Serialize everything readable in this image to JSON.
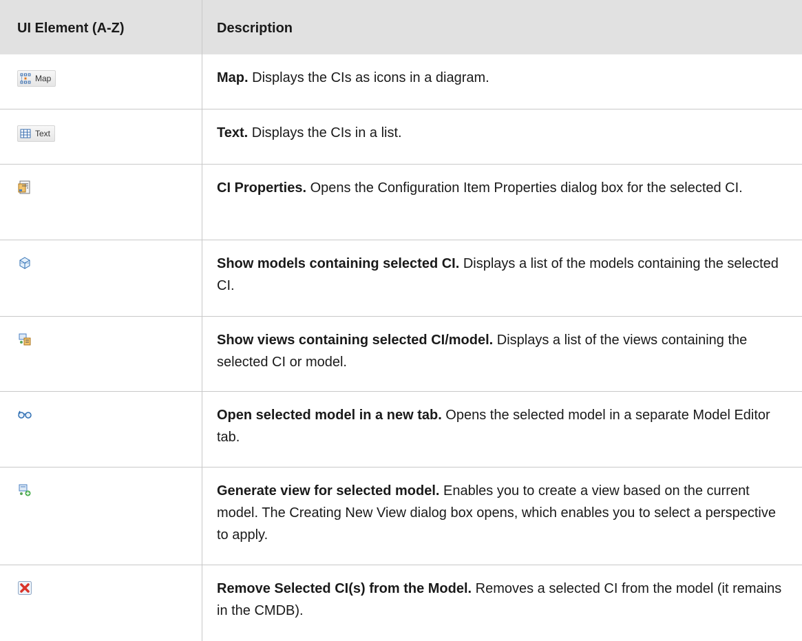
{
  "table": {
    "headers": {
      "element": "UI Element (A-Z)",
      "description": "Description"
    },
    "rows": [
      {
        "icon_name": "map-icon",
        "icon_label": "Map",
        "title": "Map.",
        "text": " Displays the CIs as icons in a diagram."
      },
      {
        "icon_name": "text-grid-icon",
        "icon_label": "Text",
        "title": "Text.",
        "text": " Displays the CIs in a list."
      },
      {
        "icon_name": "ci-properties-icon",
        "title": "CI Properties.",
        "text": " Opens the Configuration Item Properties dialog box for the selected CI."
      },
      {
        "icon_name": "models-cube-icon",
        "title": "Show models containing selected CI.",
        "text": " Displays a list of the models containing the selected CI."
      },
      {
        "icon_name": "views-icon",
        "title": "Show views containing selected CI/model.",
        "text": " Displays a list of the views containing the selected CI or model."
      },
      {
        "icon_name": "glasses-icon",
        "title": "Open selected model in a new tab.",
        "text": " Opens the selected model in a separate Model Editor tab."
      },
      {
        "icon_name": "generate-view-icon",
        "title": "Generate view for selected model.",
        "text": " Enables you to create a view based on the current model. The Creating New View dialog box opens, which enables you to select a perspective to apply."
      },
      {
        "icon_name": "remove-ci-icon",
        "title": "Remove Selected CI(s) from the Model.",
        "text": " Removes a selected CI from the model (it remains in the CMDB)."
      }
    ]
  }
}
